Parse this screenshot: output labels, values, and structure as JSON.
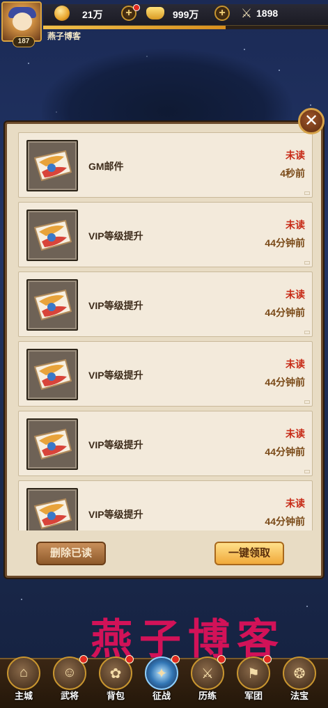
{
  "topbar": {
    "level": "187",
    "player_name": "燕子博客",
    "coins": "21万",
    "gold": "999万",
    "power": "1898",
    "exp_fraction": 0.64
  },
  "icons": {
    "coin": "coin-icon",
    "gold": "gold-ingot-icon",
    "power": "crossed-swords-icon",
    "close": "close-icon",
    "mail": "letter-icon"
  },
  "mail": {
    "items": [
      {
        "title": "GM邮件",
        "status": "未读",
        "time": "4秒前"
      },
      {
        "title": "VIP等级提升",
        "status": "未读",
        "time": "44分钟前"
      },
      {
        "title": "VIP等级提升",
        "status": "未读",
        "time": "44分钟前"
      },
      {
        "title": "VIP等级提升",
        "status": "未读",
        "time": "44分钟前"
      },
      {
        "title": "VIP等级提升",
        "status": "未读",
        "time": "44分钟前"
      },
      {
        "title": "VIP等级提升",
        "status": "未读",
        "time": "44分钟前"
      }
    ],
    "delete_read_label": "删除已读",
    "claim_all_label": "一键领取"
  },
  "watermark": "燕子博客",
  "nav": {
    "items": [
      {
        "label": "主城",
        "glyph": "⌂"
      },
      {
        "label": "武将",
        "glyph": "☺"
      },
      {
        "label": "背包",
        "glyph": "✿"
      },
      {
        "label": "征战",
        "glyph": "✦"
      },
      {
        "label": "历练",
        "glyph": "⚔"
      },
      {
        "label": "军团",
        "glyph": "⚑"
      },
      {
        "label": "法宝",
        "glyph": "❂"
      }
    ]
  },
  "colors": {
    "unread": "#c72a16",
    "time": "#7a4a18",
    "panel_bg": "#e8dcc4",
    "watermark": "#e2115a"
  }
}
